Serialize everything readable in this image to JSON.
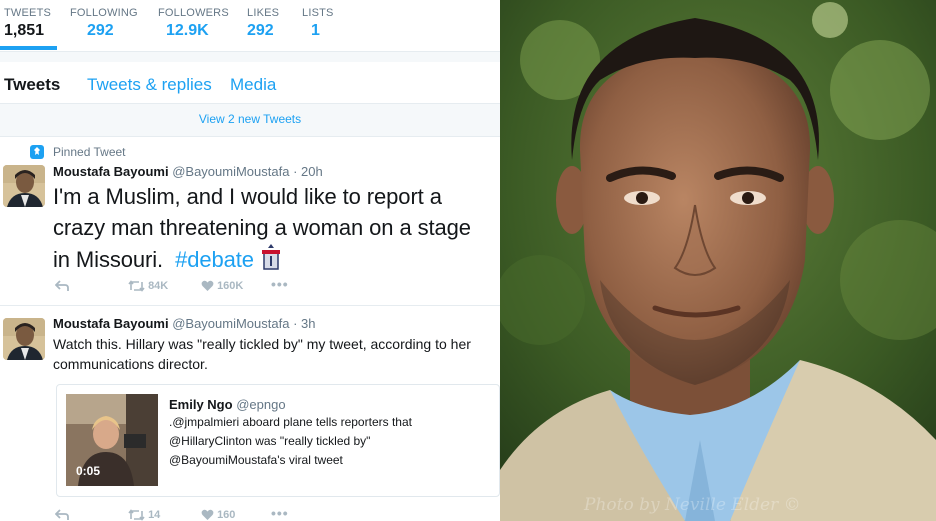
{
  "stats": [
    {
      "label": "TWEETS",
      "value": "1,851"
    },
    {
      "label": "FOLLOWING",
      "value": "292"
    },
    {
      "label": "FOLLOWERS",
      "value": "12.9K"
    },
    {
      "label": "LIKES",
      "value": "292"
    },
    {
      "label": "LISTS",
      "value": "1"
    }
  ],
  "tabs": [
    "Tweets",
    "Tweets & replies",
    "Media"
  ],
  "new_tweets_banner": "View 2 new Tweets",
  "pinned_label": "Pinned Tweet",
  "tweet1": {
    "name": "Moustafa Bayoumi",
    "handle": "@BayoumiMoustafa · 20h",
    "lines": [
      "I'm a Muslim, and I would like to report a",
      "crazy man threatening a woman on a stage"
    ],
    "line3": "in Missouri.",
    "hashtag": "#debate",
    "retweets": "84K",
    "likes": "160K"
  },
  "tweet2": {
    "name": "Moustafa Bayoumi",
    "handle": "@BayoumiMoustafa · 3h",
    "lines": [
      "Watch this. Hillary was \"really tickled by\" my tweet, according to her",
      "communications director."
    ],
    "retweets": "14",
    "likes": "160"
  },
  "quote": {
    "name": "Emily Ngo",
    "handle": "@epngo",
    "lines": [
      ".@jmpalmieri aboard plane tells reporters that",
      "@HillaryClinton was \"really tickled by\"",
      "@BayoumiMoustafa's viral tweet"
    ],
    "video_time": "0:05"
  },
  "photo_credit": "Photo by Neville Elder ©",
  "colors": {
    "accent": "#1da1f2",
    "muted": "#657786",
    "divider": "#e6ecf0"
  }
}
